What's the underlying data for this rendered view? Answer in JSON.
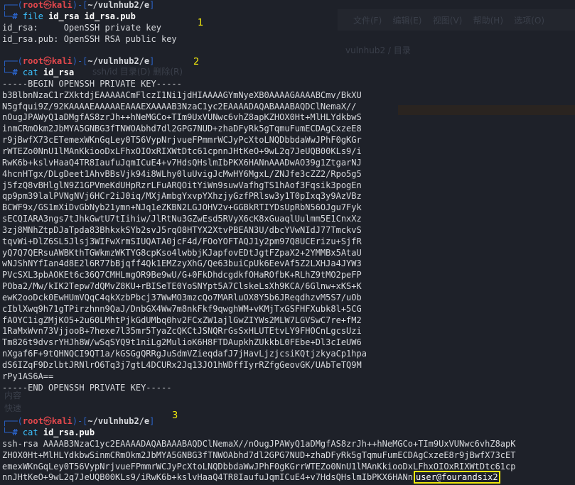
{
  "colors": {
    "background": "#1e2129",
    "prompt_frame": "#2a63c9",
    "prompt_user": "#e5484d",
    "command": "#3cc2ff",
    "output": "#d7d9dd",
    "annotation": "#f1e80d"
  },
  "background_ghost": {
    "menu_items": [
      "文件(F)",
      "编辑(E)",
      "视图(V)",
      "帮助(H)",
      "选项(O)"
    ],
    "breadcrumb": "vulnhub2 / 目录",
    "sub_path": "ssh/id  目录(D)  删除(R)",
    "label_a": "快速",
    "label_b": "内容"
  },
  "prompt": {
    "frame_top": "┌──(",
    "user": "root",
    "skull": "㉿",
    "host": "kali",
    "frame_mid": ")-[",
    "path": "~/vulnhub2/e",
    "frame_end": "]",
    "frame_bottom": "└─",
    "hash": "#"
  },
  "annotations": [
    "1",
    "2",
    "3"
  ],
  "block1": {
    "cmd": "file",
    "args": "id_rsa id_rsa.pub",
    "output": [
      "id_rsa:     OpenSSH private key",
      "id_rsa.pub: OpenSSH RSA public key"
    ]
  },
  "block2": {
    "cmd": "cat",
    "args": "id_rsa",
    "output": [
      "-----BEGIN OPENSSH PRIVATE KEY-----",
      "b3BlbnNzaC1rZXktdjEAAAAACmFlczI1Ni1jdHIAAAAGYmNyeXB0AAAAGAAAABCmv/BkXU",
      "N5gfqui9Z/92KAAAAEAAAAAEAAAEXAAAAB3NzaC1yc2EAAAADAQABAAABAQDClNemaX//",
      "nOugJPAWyQ1aDMgfAS8zrJh++hNeMGCo+TIm9UxVUNwc6vhZ8apKZHOX0Ht+MlHLYdkbwS",
      "inmCRmOkm2JbMYA5GNBG3fTNWOAbhd7dl2GPG7NUD+zhaDFyRk5gTqmuFumECDAgCxzeE8",
      "r9jBwfX73cETemexWKnGqLey0T56VypNrjvueFPmmrWCJyPcXtoLNQDbbdaWwJPhF0gKGr",
      "rWTEZo0NnU1lMAnKkiooDxLFhxOIOxRIXWtDtc61cpnnJHtKeO+9wL2q7JeUQB00KLs9/i",
      "RwK6b+kslvHaaQ4TR8IaufuJqmICuE4+v7HdsQHslmIbPKX6HANnAAADwAO39g1ZtgarNJ",
      "4hcnHTgx/DLgDeet1AhvBBsVjk94i8WLhy0luUvigJcMwHY6MgxL/ZNJfe3cZZ2/Rpo5g5",
      "j5fzQ8vBHlglN9Z1GPVmeKdUHpRzrLFuARQOitYiWn9suwVafhgTS1hAof3Fqsik3pogEn",
      "qp9pm39lalPVNgNVj6HCr2iJ0iq/MXjAmbgYxvpYXhzjyGzfPRlsw3y1T0pIxq3y9AzVBz",
      "BCWF9x/GS1mXiDvGbNyb21ymn+NJq1eZKBN2LGJOHV2v+GGBkRTIYDsUpRbN56OJgu7Fyk",
      "sECQIARA3ngs7tJhkGwtU7tIihiw/JlRtNu3GZwEsd5RVyX6cK8xGuaqlUulmm5E1CnxXz",
      "3zj8MNhZtpDJaTpda83BhkxkSYb2svJ5rqO8HTYX2XtvPBEAN3U/dbcYVwNIdJ77TmckvS",
      "tqvWi+DlZ6SL5Jlsj3WIFwXrmSIUQATA0jcF4d/FOoYOFTAQJ1y2pm97Q8UCErizu+SjfR",
      "yQ7Q7QERsuAWBKthTGWkmzWKTYG8cpKso4lwbbjKJapfovEDtJgtFZpaX2+2YMMBx5AtaU",
      "wNJShNYfIan4d8E2l6R77bBjqff4Qk1EMZzyXhG/Qe63buiCpUk6EevAf5Z2LXHJa4JYW3",
      "PVcSXL3pbAOKEt6c36Q7CMHLmgOR9Be9wU/G+0FkDhdcgdkfOHaROfbK+RLhZ9tMO2peFP",
      "POba2/Mw/kIK2Tepw7dQMvZ8KU+rBISeTE0YoSNYpt5A7ClskeLsXh9KCA/6Glnw+xKS+K",
      "ewK2ooDck0EwHUmVQqC4qkXzbPbcj37WwMO3mzcQo7MARluOX8Y5b6JReqdhzvM5S7/uOb",
      "cIblXwq9h71gTPirzhnn9QaJ/DnbGX4Ww7m8nkFkf9qwghWM+vKMjTxGSFHFXubk8l+5CG",
      "fAOYC1igZMjKO5+2u60LMhtPjkGdUMbq0hv2FCxZW1ajlGwZIYWs2MLW7LGVSwC7re+fM2",
      "1RaMxWvn73VjjooB+7hexe7l35mr5TyaZcQKCtJSNQRrGsSxHLUTEtvLY9FHOCnLgcsUzi",
      "Tm826t9dvsrYHJh8W/wSqSYQ9t1niLg2MulioK6H8FTDAupkhZUkkbL0FEbe+Dl3cIeUW6",
      "nXgaf6F+9tQHNQCI9QT1a/kGSGgQRRgJuSdmVZieqdafJ7jHavLjzjcsiKQtjzkyaCp1hpa",
      "dS6IZqF9DzlbtJRNlrO6Tq3j7gtL4DCURx2Jq13JO1hWDffIyrRZfgGeovGK/UAbTeTQ9M",
      "rPy1AS6A==",
      "-----END OPENSSH PRIVATE KEY-----"
    ]
  },
  "block3": {
    "cmd": "cat",
    "args": "id_rsa.pub",
    "output": [
      "ssh-rsa AAAAB3NzaC1yc2EAAAADAQABAAABAQDClNemaX//nOugJPAWyQ1aDMgfAS8zrJh++hNeMGCo+TIm9UxVUNwc6vhZ8apK",
      "ZHOX0Ht+MlHLYdkbwSinmCRmOkm2JbMYA5GNBG3fTNWOAbhd7dl2GPG7NUD+zhaDFyRk5gTqmuFumECDAgCxzeE8r9jBwfX73cET",
      "emexWKnGqLey0T56VypNrjvueFPmmrWCJyPcXtoLNQDbbdaWwJPhF0gKGrrWTEZo0NnU1lMAnKkiooDxLFhxOIOxRIXWtDtc61cp"
    ],
    "last_line_prefix": "nnJHtKeO+9wL2q7JeUQB00KLs9/iRwK6b+kslvHaaQ4TR8IaufuJqmICuE4+v7HdsQHslmIbPKX6HANn",
    "user": "user@fourandsix2"
  }
}
